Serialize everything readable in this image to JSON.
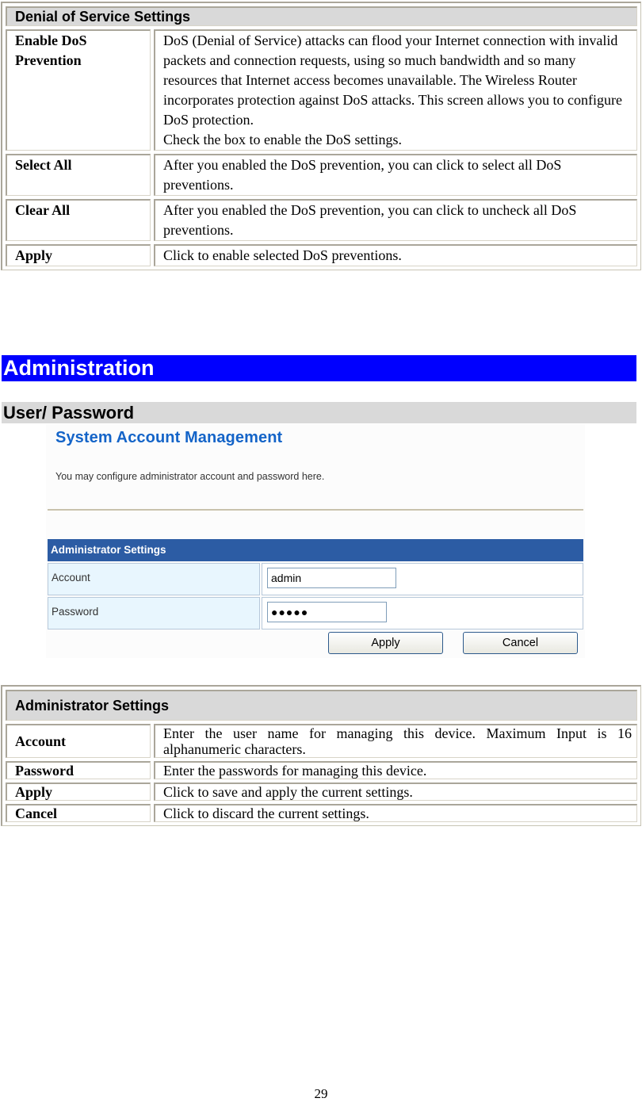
{
  "dos_table": {
    "header": "Denial of Service Settings",
    "rows": [
      {
        "label": "Enable DoS Prevention",
        "desc": "DoS (Denial of Service) attacks can flood your Internet connection with invalid packets and connection requests, using so much bandwidth and so many resources that Internet access becomes unavailable. The Wireless Router incorporates protection against DoS attacks. This screen allows you to configure DoS protection.",
        "desc2": "Check the box to enable the DoS settings."
      },
      {
        "label": "Select All",
        "desc": "After you enabled the DoS prevention, you can click to select all DoS preventions."
      },
      {
        "label": "Clear All",
        "desc": "After you enabled the DoS prevention, you can click to uncheck all DoS preventions."
      },
      {
        "label": "Apply",
        "desc": "Click to enable selected DoS preventions."
      }
    ]
  },
  "sections": {
    "administration": "Administration",
    "user_password": "User/ Password"
  },
  "screenshot": {
    "title": "System Account Management",
    "subtitle": "You may configure administrator account and password here.",
    "settings_header": "Administrator Settings",
    "account_label": "Account",
    "account_value": "admin",
    "password_label": "Password",
    "password_value": "●●●●●",
    "apply_label": "Apply",
    "cancel_label": "Cancel"
  },
  "admin_table": {
    "header": "Administrator Settings",
    "rows": [
      {
        "label": "Account",
        "desc": "Enter the user name for managing this device. Maximum Input is 16 alphanumeric characters."
      },
      {
        "label": "Password",
        "desc": "Enter the passwords for managing this device."
      },
      {
        "label": "Apply",
        "desc": "Click to save and apply the current settings."
      },
      {
        "label": "Cancel",
        "desc": "Click to discard the current settings."
      }
    ]
  },
  "page_number": "29"
}
